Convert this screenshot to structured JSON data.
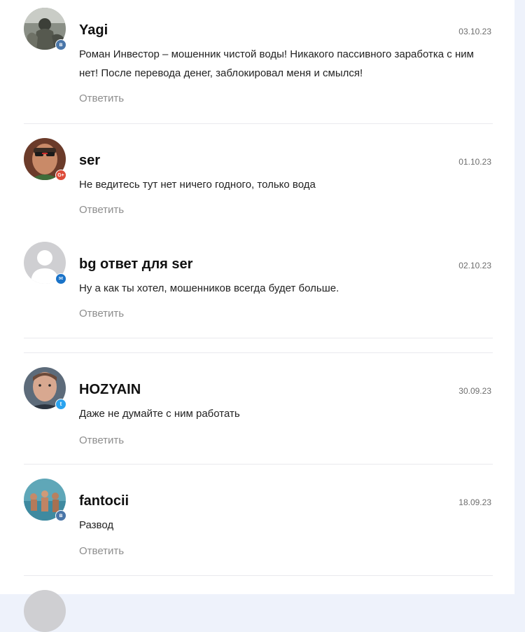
{
  "comments": [
    {
      "author": "Yagi",
      "date": "03.10.23",
      "text": "Роман Инвестор – мошенник чистой воды! Никакого пассивного заработка с ним нет! После перевода денег, заблокировал меня и смылся!",
      "reply": "Ответить",
      "social_icon": "vk-icon"
    },
    {
      "author": "ser",
      "date": "01.10.23",
      "text": "Не ведитесь тут нет ничего годного, только вода",
      "reply": "Ответить",
      "social_icon": "google-plus-icon"
    },
    {
      "author": "bg ответ для ser",
      "date": "02.10.23",
      "text": "Ну а как ты хотел, мошенников всегда будет больше.",
      "reply": "Ответить",
      "social_icon": "mail-icon"
    },
    {
      "author": "HOZYAIN",
      "date": "30.09.23",
      "text": "Даже не думайте с ним работать",
      "reply": "Ответить",
      "social_icon": "twitter-icon"
    },
    {
      "author": "fantocii",
      "date": "18.09.23",
      "text": "Развод",
      "reply": "Ответить",
      "social_icon": "vk-icon"
    }
  ],
  "colors": {
    "page_bg": "#eef2fb",
    "panel_bg": "#ffffff",
    "reply": "#8d8d8d",
    "date": "#6d6d6d",
    "vk": "#4a76a8",
    "google_plus": "#dd4b39",
    "mail": "#1a73c8",
    "twitter": "#2aa3ef"
  }
}
